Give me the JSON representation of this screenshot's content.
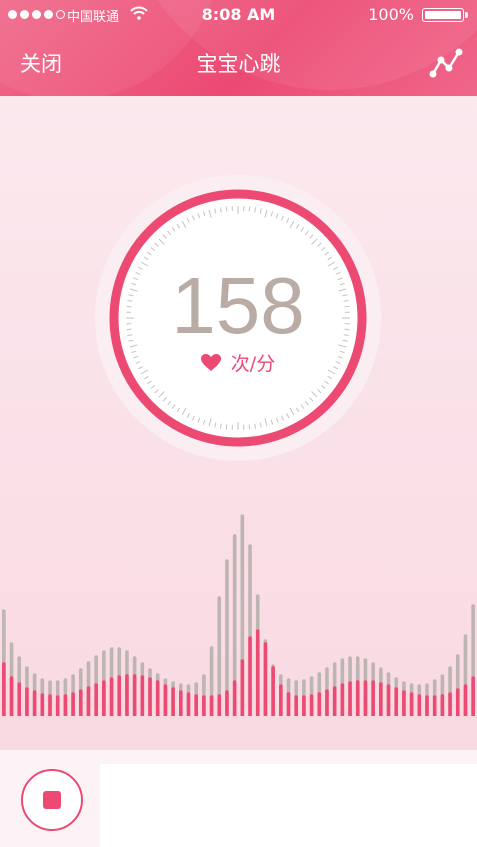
{
  "status_bar": {
    "carrier": "中国联通",
    "time": "8:08 AM",
    "battery": "100%",
    "signal_icon": "signal-dots-icon",
    "wifi_icon": "wifi-icon",
    "battery_icon": "battery-icon"
  },
  "nav": {
    "close_label": "关闭",
    "title": "宝宝心跳",
    "chart_icon": "line-chart-icon"
  },
  "heart_rate": {
    "value": "158",
    "unit": "次/分",
    "heart_icon": "heart-icon"
  },
  "waveform": {
    "colors": {
      "pink": "#ec4a73",
      "gray": "#bdb5b1"
    },
    "pink": [
      52,
      38,
      32,
      27,
      24,
      21,
      20,
      19,
      20,
      22,
      25,
      28,
      31,
      34,
      37,
      39,
      40,
      40,
      39,
      37,
      34,
      30,
      27,
      24,
      22,
      20,
      19,
      19,
      20,
      24,
      34,
      55,
      78,
      85,
      72,
      48,
      30,
      22,
      19,
      19,
      20,
      22,
      25,
      28,
      31,
      33,
      34,
      34,
      34,
      32,
      30,
      27,
      24,
      22,
      20,
      19,
      19,
      20,
      22,
      26,
      30,
      38
    ],
    "gray": [
      105,
      72,
      58,
      48,
      41,
      36,
      34,
      34,
      36,
      40,
      46,
      53,
      59,
      64,
      67,
      67,
      64,
      58,
      52,
      46,
      41,
      36,
      33,
      31,
      30,
      32,
      40,
      68,
      118,
      155,
      180,
      200,
      170,
      120,
      75,
      50,
      40,
      36,
      34,
      35,
      38,
      42,
      47,
      52,
      56,
      58,
      58,
      56,
      52,
      47,
      42,
      37,
      33,
      31,
      30,
      31,
      35,
      40,
      48,
      60,
      80,
      110
    ]
  },
  "controls": {
    "stop_icon": "stop-icon"
  }
}
